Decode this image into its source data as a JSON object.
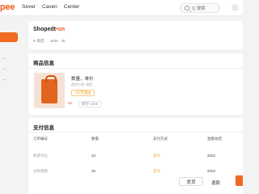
{
  "brand": "pee",
  "nav": [
    "Sever",
    "Caven",
    "Center"
  ],
  "search": {
    "placeholder": "Q 搜索"
  },
  "shop": {
    "name_main": "Shopedt",
    "name_accent": "•on",
    "rating": "R 家结",
    "follow": "Bale · 36"
  },
  "product": {
    "section_title": "商品信息",
    "name": "数量，单价",
    "spec": "颜色分类: 橙色",
    "tag": "7天无理由",
    "price": "¥2",
    "stock": "库存 1000"
  },
  "payment": {
    "section_title": "支付信息",
    "headers": [
      "订单编号",
      "数量",
      "支付方式",
      "金额总结"
    ],
    "rows": [
      [
        "数量单位",
        "34",
        "支付",
        "2022"
      ],
      [
        "总数量数",
        "32",
        "支付",
        "2022"
      ]
    ]
  },
  "actions": {
    "secondary": "发货",
    "text": "退款"
  },
  "colors": {
    "accent": "#f06a20",
    "brand": "#f05a1a"
  }
}
